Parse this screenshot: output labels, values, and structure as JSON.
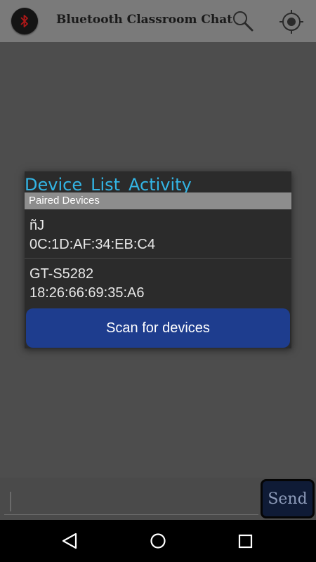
{
  "app": {
    "title": "Bluetooth Classroom Chat",
    "logo_icon": "bluetooth-icon",
    "actions": [
      {
        "name": "search-button",
        "icon": "search-icon"
      },
      {
        "name": "locate-button",
        "icon": "crosshair-icon"
      }
    ]
  },
  "dialog": {
    "title": "Device_List_Activity",
    "section_header": "Paired Devices",
    "devices": [
      {
        "name": "ñJ",
        "address": "0C:1D:AF:34:EB:C4"
      },
      {
        "name": "GT-S5282",
        "address": "18:26:66:69:35:A6"
      }
    ],
    "scan_button": "Scan for devices"
  },
  "compose": {
    "input_value": "",
    "input_placeholder": "",
    "send_label": "Send"
  },
  "navbar": {
    "back_icon": "back-triangle-icon",
    "home_icon": "home-circle-icon",
    "recent_icon": "recent-apps-square-icon"
  },
  "colors": {
    "title_accent": "#33b5e5",
    "scan_button_bg": "#1e3d8e",
    "send_button_bg": "#0f1b36"
  }
}
